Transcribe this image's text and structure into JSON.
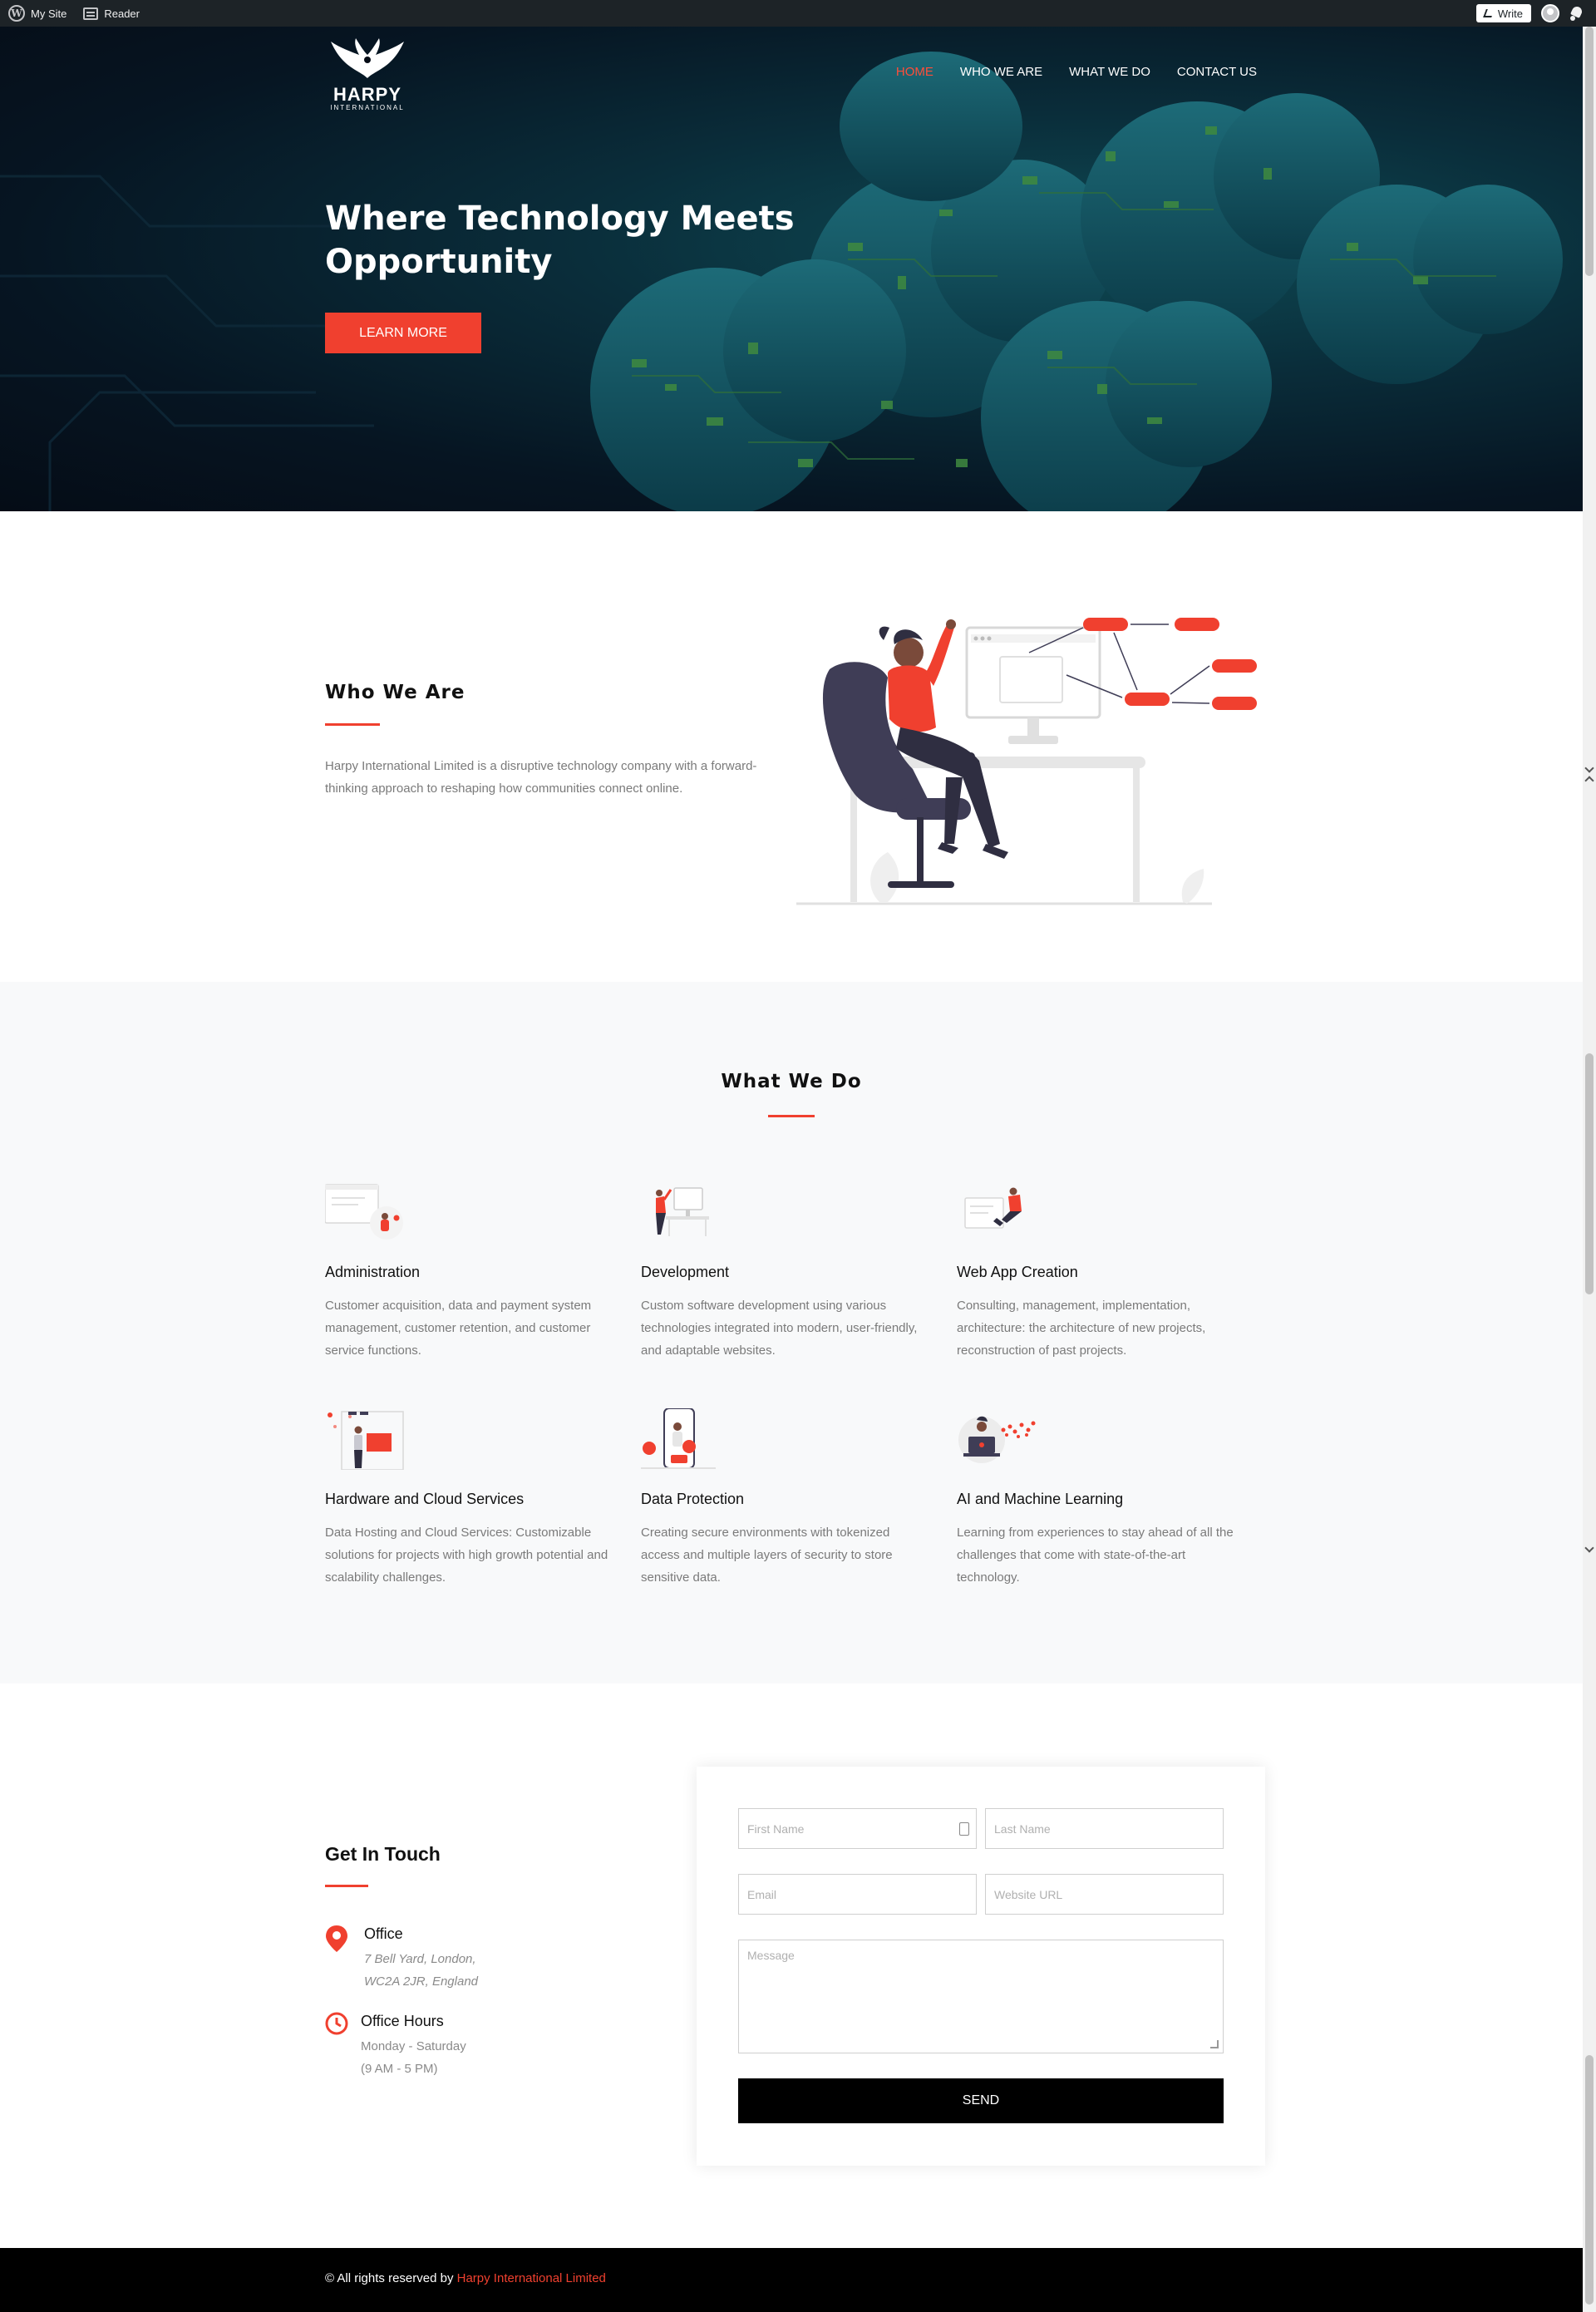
{
  "adminbar": {
    "my_site_label": "My Site",
    "reader_label": "Reader",
    "write_label": "Write",
    "icons": [
      "wordpress-logo-icon",
      "reader-icon",
      "pen-icon",
      "avatar-icon",
      "notification-bell-icon"
    ]
  },
  "header": {
    "logo_brand": "HARPY",
    "logo_sub": "INTERNATIONAL",
    "nav": [
      {
        "label": "HOME",
        "active": true
      },
      {
        "label": "WHO WE ARE",
        "active": false
      },
      {
        "label": "WHAT WE DO",
        "active": false
      },
      {
        "label": "CONTACT US",
        "active": false
      }
    ]
  },
  "hero": {
    "title": "Where Technology Meets Opportunity",
    "button_label": "LEARN MORE"
  },
  "who": {
    "title": "Who We Are",
    "text": "Harpy International Limited is a disruptive technology company with a forward-thinking approach to reshaping how communities connect online."
  },
  "what": {
    "title": "What We Do",
    "services": [
      {
        "name": "Administration",
        "desc": "Customer acquisition, data and payment system management, customer retention, and customer service functions."
      },
      {
        "name": "Development",
        "desc": "Custom software development using various technologies integrated into modern, user-friendly, and adaptable websites."
      },
      {
        "name": "Web App Creation",
        "desc": "Consulting, management, implementation, architecture: the architecture of new projects, reconstruction of past projects."
      },
      {
        "name": "Hardware and Cloud Services",
        "desc": "Data Hosting and Cloud Services: Customizable solutions for projects with high growth potential and scalability challenges."
      },
      {
        "name": "Data Protection",
        "desc": "Creating secure environments with tokenized access and multiple layers of security to store sensitive data."
      },
      {
        "name": "AI and Machine Learning",
        "desc": "Learning from experiences to stay ahead of all the challenges that come with state-of-the-art technology."
      }
    ]
  },
  "contact": {
    "title": "Get In Touch",
    "office_label": "Office",
    "office_line1": "7 Bell Yard, London,",
    "office_line2": "WC2A 2JR, England",
    "hours_label": "Office Hours",
    "hours_line1": "Monday - Saturday",
    "hours_line2": "(9 AM - 5 PM)",
    "form": {
      "first_name_placeholder": "First Name",
      "last_name_placeholder": "Last Name",
      "email_placeholder": "Email",
      "website_placeholder": "Website URL",
      "message_placeholder": "Message",
      "send_label": "SEND"
    }
  },
  "footer": {
    "prefix": "© All rights reserved by ",
    "company": "Harpy International Limited"
  },
  "colors": {
    "accent": "#f0402f",
    "admin_bar": "#1d2327",
    "section_alt": "#f8f9fa",
    "footer": "#000000"
  }
}
